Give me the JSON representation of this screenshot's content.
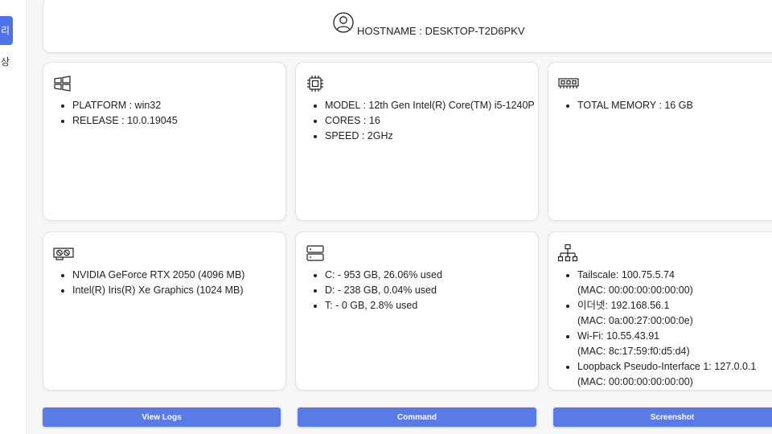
{
  "sidebar": {
    "active_label": "리",
    "item_label": "상"
  },
  "host": {
    "hostname_text": "HOSTNAME : DESKTOP-T2D6PKV"
  },
  "os_card": {
    "icon": "windows-icon",
    "items": [
      "PLATFORM : win32",
      "RELEASE : 10.0.19045"
    ]
  },
  "cpu_card": {
    "icon": "cpu-icon",
    "items": [
      "MODEL : 12th Gen Intel(R) Core(TM) i5-1240P",
      "CORES : 16",
      "SPEED : 2GHz"
    ]
  },
  "memory_card": {
    "icon": "memory-icon",
    "items": [
      "TOTAL MEMORY : 16 GB"
    ]
  },
  "gpu_card": {
    "icon": "gpu-icon",
    "items": [
      "NVIDIA GeForce RTX 2050 (4096 MB)",
      "Intel(R) Iris(R) Xe Graphics (1024 MB)"
    ]
  },
  "disk_card": {
    "icon": "storage-icon",
    "items": [
      "C: - 953 GB, 26.06% used",
      "D: - 238 GB, 0.04% used",
      "T: - 0 GB, 2.8% used"
    ]
  },
  "network_card": {
    "icon": "network-icon",
    "items": [
      {
        "name": "Tailscale: 100.75.5.74",
        "mac": "(MAC: 00:00:00:00:00:00)"
      },
      {
        "name": "이더넷: 192.168.56.1",
        "mac": "(MAC: 0a:00:27:00:00:0e)"
      },
      {
        "name": "Wi-Fi: 10.55.43.91",
        "mac": "(MAC: 8c:17:59:f0:d5:d4)"
      },
      {
        "name": "Loopback Pseudo-Interface 1: 127.0.0.1",
        "mac": "(MAC: 00:00:00:00:00:00)"
      }
    ]
  },
  "buttons": {
    "view_logs": "View Logs",
    "command": "Command",
    "screenshot": "Screenshot"
  },
  "colors": {
    "accent": "#5a7be6"
  }
}
